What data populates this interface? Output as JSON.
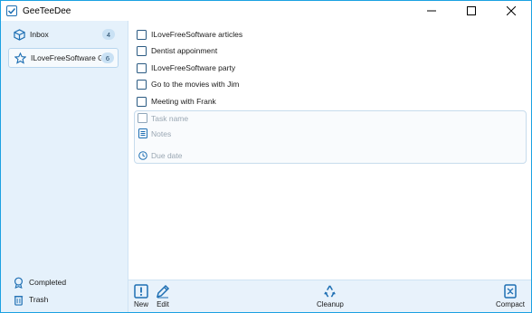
{
  "window": {
    "title": "GeeTeeDee"
  },
  "sidebar": {
    "lists": [
      {
        "label": "Inbox",
        "count": "4",
        "icon": "cube-icon"
      },
      {
        "label": "ILoveFreeSoftware Gr",
        "count": "6",
        "icon": "star-icon"
      }
    ],
    "completed_label": "Completed",
    "trash_label": "Trash"
  },
  "tasks": [
    {
      "label": "ILoveFreeSoftware articles"
    },
    {
      "label": "Dentist appoinment"
    },
    {
      "label": "ILoveFreeSoftware party"
    },
    {
      "label": "Go to the movies with Jim"
    },
    {
      "label": "Meeting with Frank"
    }
  ],
  "new_task": {
    "name_placeholder": "Task name",
    "notes_placeholder": "Notes",
    "due_placeholder": "Due date"
  },
  "toolbar": {
    "new_label": "New",
    "edit_label": "Edit",
    "cleanup_label": "Cleanup",
    "compact_label": "Compact"
  },
  "colors": {
    "accent": "#1e6fb3",
    "sidebar_bg": "#e5f1fb",
    "toolbar_bg": "#e8f2fb"
  }
}
